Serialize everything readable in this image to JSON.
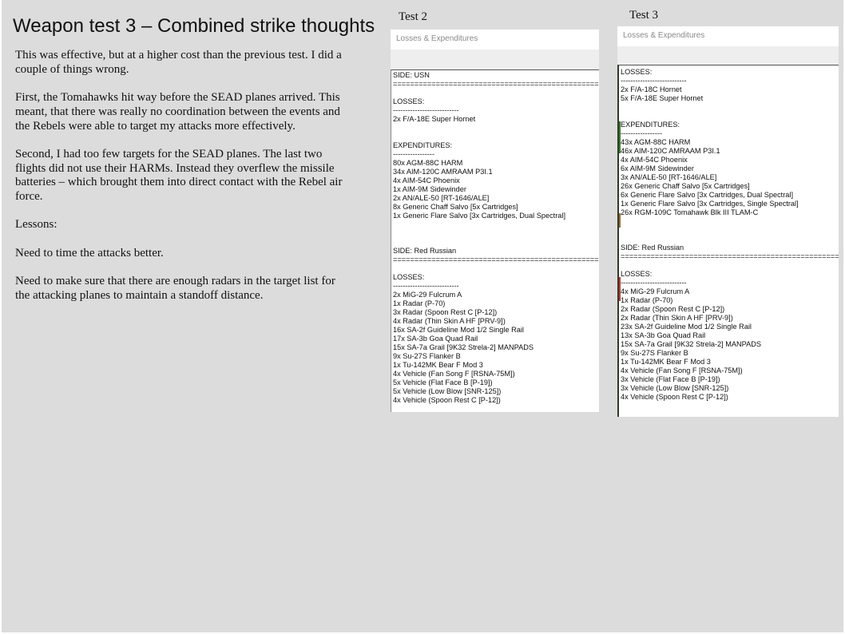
{
  "slide": {
    "title": "Weapon test 3 – Combined strike thoughts",
    "paragraphs": [
      "This was effective, but at a higher cost than the previous test.  I did a couple of things wrong.",
      "First, the Tomahawks hit way before the SEAD planes arrived.  This meant, that there was really no coordination between the events and the Rebels were able to target my attacks more effectively.",
      "Second, I had too few targets for the SEAD planes.  The last two flights did not use their HARMs.  Instead they overflew the missile batteries – which brought them into direct contact with the Rebel air force.",
      "Lessons:",
      "Need to time the attacks better.",
      "Need to make sure that there are enough radars in the target list for the attacking planes to maintain a standoff distance."
    ]
  },
  "test2": {
    "caption": "Test 2",
    "window_title": "Losses & Expenditures",
    "lines": [
      "SIDE: USN",
      "=====================================================",
      "",
      "LOSSES:",
      "---------------------------",
      "2x F/A-18E Super Hornet",
      "",
      "",
      "EXPENDITURES:",
      "-----------------",
      "80x AGM-88C HARM",
      "34x AIM-120C AMRAAM P3I.1",
      "4x AIM-54C Phoenix",
      "1x AIM-9M Sidewinder",
      "2x AN/ALE-50 [RT-1646/ALE]",
      "8x Generic Chaff Salvo [5x Cartridges]",
      "1x Generic Flare Salvo [3x Cartridges, Dual Spectral]",
      "",
      "",
      "",
      "SIDE: Red Russian",
      "=====================================================",
      "",
      "LOSSES:",
      "---------------------------",
      "2x MiG-29 Fulcrum A",
      "1x Radar (P-70)",
      "3x Radar (Spoon Rest C [P-12])",
      "4x Radar (Thin Skin A HF [PRV-9])",
      "16x SA-2f Guideline Mod 1/2 Single Rail",
      "17x SA-3b Goa Quad Rail",
      "15x SA-7a Grail [9K32 Strela-2] MANPADS",
      "9x Su-27S Flanker B",
      "1x Tu-142MK Bear F Mod 3",
      "4x Vehicle (Fan Song F [RSNA-75M])",
      "5x Vehicle (Flat Face B [P-19])",
      "5x Vehicle (Low Blow [SNR-125])",
      "4x Vehicle (Spoon Rest C [P-12])"
    ]
  },
  "test3": {
    "caption": "Test 3",
    "window_title": "Losses & Expenditures",
    "lines": [
      "LOSSES:",
      "---------------------------",
      "2x F/A-18C Hornet",
      "5x F/A-18E Super Hornet",
      "",
      "",
      "EXPENDITURES:",
      "-----------------",
      "43x AGM-88C HARM",
      "46x AIM-120C AMRAAM P3I.1",
      "4x AIM-54C Phoenix",
      "6x AIM-9M Sidewinder",
      "3x AN/ALE-50 [RT-1646/ALE]",
      "26x Generic Chaff Salvo [5x Cartridges]",
      "6x Generic Flare Salvo [3x Cartridges, Dual Spectral]",
      "1x Generic Flare Salvo [3x Cartridges, Single Spectral]",
      "26x RGM-109C Tomahawk Blk III TLAM-C",
      "",
      "",
      "",
      "SIDE: Red Russian",
      "==============================================================",
      "",
      "LOSSES:",
      "---------------------------",
      "4x MiG-29 Fulcrum A",
      "1x Radar (P-70)",
      "2x Radar (Spoon Rest C [P-12])",
      "2x Radar (Thin Skin A HF [PRV-9])",
      "23x SA-2f Guideline Mod 1/2 Single Rail",
      "13x SA-3b Goa Quad Rail",
      "15x SA-7a Grail [9K32 Strela-2] MANPADS",
      "9x Su-27S Flanker B",
      "1x Tu-142MK Bear F Mod 3",
      "4x Vehicle (Fan Song F [RSNA-75M])",
      "3x Vehicle (Flat Face B [P-19])",
      "3x Vehicle (Low Blow [SNR-125])",
      "4x Vehicle (Spoon Rest C [P-12])"
    ]
  }
}
